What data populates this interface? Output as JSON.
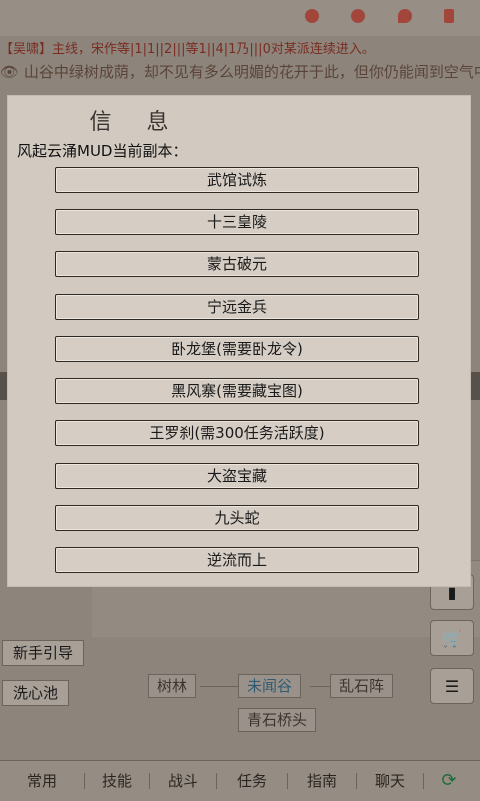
{
  "background": {
    "chat_line": "【吴啸】主线，宋作等|1|1||2|||等1||4|1乃|||0对某派连续进入。",
    "description": "山谷中绿树成荫，却不见有多么明媚的花开于此，但你仍能闻到空气中飘来的花香，耳边听到了远处叮咚的泉音，再走不远处",
    "left_buttons": [
      "新手引导",
      "洗心池"
    ],
    "rooms": {
      "west": "树林",
      "current": "未闻谷",
      "east": "乱石阵",
      "south": "青石桥头"
    },
    "side_icons": [
      "trash-icon",
      "cart-icon",
      "list-icon"
    ],
    "bottom_tabs": [
      "常用",
      "技能",
      "战斗",
      "任务",
      "指南",
      "聊天"
    ],
    "colors": {
      "overlay": "#8d857c",
      "dialog": "#d2cac1",
      "current_room": "#2f5b72",
      "refresh": "#1e6b3a"
    }
  },
  "dialog": {
    "title": "信 息",
    "header": "风起云涌MUD当前副本：",
    "instances": [
      "武馆试炼",
      "十三皇陵",
      "蒙古破元",
      "宁远金兵",
      "卧龙堡(需要卧龙令)",
      "黑风寨(需要藏宝图)",
      "王罗刹(需300任务活跃度)",
      "大盗宝藏",
      "九头蛇",
      "逆流而上"
    ]
  }
}
